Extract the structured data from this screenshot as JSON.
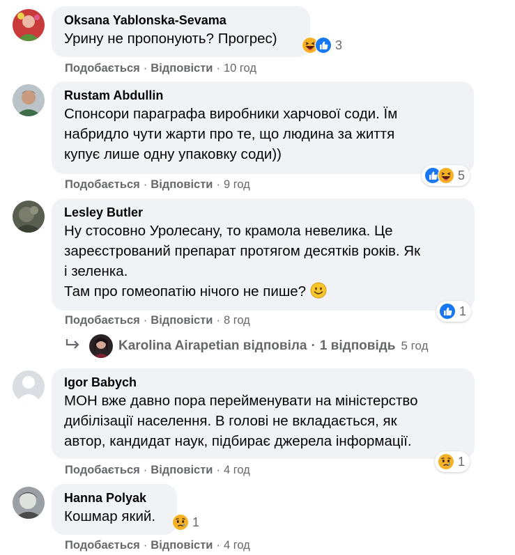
{
  "actions": {
    "like": "Подобається",
    "reply": "Відповісти",
    "separator": "·"
  },
  "comments": [
    {
      "author": "Oksana Yablonska-Sevama",
      "lines": [
        "Урину не пропонують? Прогрес)"
      ],
      "time": "10 год",
      "reactions": [
        "haha-icon",
        "like-icon"
      ],
      "count": "3"
    },
    {
      "author": "Rustam Abdullin",
      "lines": [
        "Спонсори параграфа виробники харчової соди. Їм",
        "набридло чути жарти про те, що людина за життя",
        "купує лише одну упаковку соди))"
      ],
      "time": "9 год",
      "reactions": [
        "like-icon",
        "haha-icon"
      ],
      "count": "5"
    },
    {
      "author": "Lesley Butler",
      "lines": [
        "Ну стосовно Уролесану, то крамола невелика. Це",
        "зареєстрований препарат протягом десятків років. Як",
        "і зеленка.",
        "Там про гомеопатію нічого не пише?"
      ],
      "time": "8 год",
      "reactions": [
        "like-icon"
      ],
      "count": "1"
    },
    {
      "author": "Igor Babych",
      "lines": [
        "МОН вже давно пора перейменувати на міністерство",
        "дибілізації населення. В голові не вкладається, як",
        "автор, кандидат наук, підбирає джерела інформації."
      ],
      "time": "4 год",
      "reactions": [
        "sad-icon"
      ],
      "count": "1"
    },
    {
      "author": "Hanna Polyak",
      "lines": [
        "Кошмар який."
      ],
      "time": "4 год",
      "reactions": [
        "sad-icon"
      ],
      "count": "1"
    }
  ],
  "reply_thread": {
    "author": "Karolina Airapetian",
    "verb": "відповіла",
    "separator": "·",
    "count_label": "1 відповідь",
    "time": "5 год"
  },
  "colors": {
    "bubble": "#f0f2f5",
    "secondary_text": "#65676b",
    "like_blue": "#1877f2",
    "emoji_yellow": "#f7b125"
  }
}
